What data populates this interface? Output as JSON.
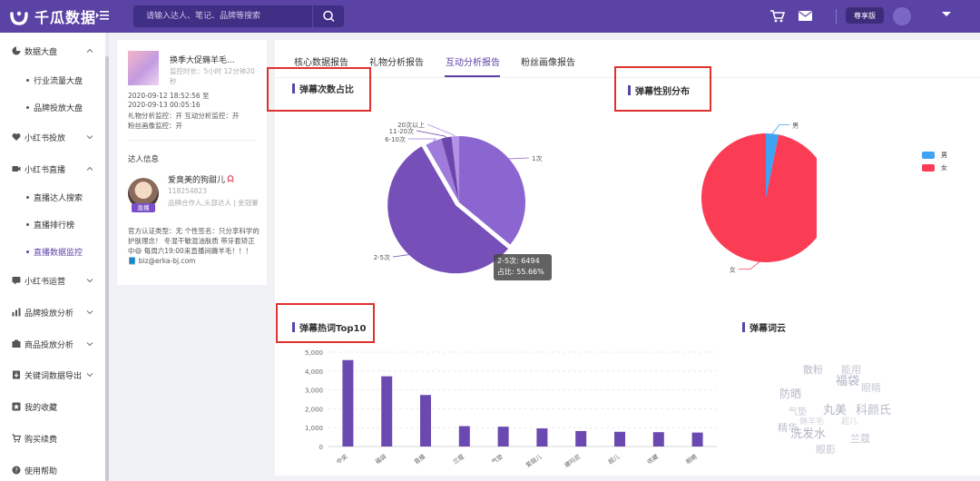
{
  "header": {
    "logo_text": "千瓜数据",
    "search_placeholder": "请输入达人、笔记、品牌等搜索",
    "vip_label": "尊享版"
  },
  "sidebar": {
    "items": [
      {
        "label": "数据大盘",
        "icon": "pie-icon"
      },
      {
        "label": "行业流量大盘",
        "sub": true
      },
      {
        "label": "品牌投放大盘",
        "sub": true
      },
      {
        "label": "小红书投放",
        "icon": "heart-icon"
      },
      {
        "label": "小红书直播",
        "icon": "video-icon"
      },
      {
        "label": "直播达人搜索",
        "sub": true
      },
      {
        "label": "直播排行榜",
        "sub": true
      },
      {
        "label": "直播数据监控",
        "sub": true,
        "active": true
      },
      {
        "label": "小红书运营",
        "icon": "chat-icon"
      },
      {
        "label": "品牌投放分析",
        "icon": "bar-icon"
      },
      {
        "label": "商品投放分析",
        "icon": "goods-icon"
      },
      {
        "label": "关键词数据导出",
        "icon": "export-icon"
      },
      {
        "label": "我的收藏",
        "icon": "star-icon"
      },
      {
        "label": "购买续费",
        "icon": "cart-icon"
      },
      {
        "label": "使用帮助",
        "icon": "help-icon"
      }
    ]
  },
  "live": {
    "title": "换季大促薅羊毛...",
    "duration": "监控时长：5小时 12分钟20秒",
    "lines": [
      "2020-09-12 18:52:56 至",
      "2020-09-13 00:05:16",
      "礼物分析监控：开    互动分析监控：开",
      "粉丝画像监控：开"
    ]
  },
  "kol": {
    "section_title": "达人信息",
    "live_tag": "直播",
    "name": "爱臭美的狗甜儿",
    "id": "118254823",
    "tags": "品牌合作人,头部达人  | 金冠薯",
    "desc": "官方认证类型：无 个性签名：只分享科学的护肤理念！ 冬混干敏混油肤质 带牙套矫正中😄 每周六19:00来直播间薅羊毛！！！ 📘 biz@erka-bj.com"
  },
  "tabs": [
    {
      "label": "核心数据报告"
    },
    {
      "label": "礼物分析报告"
    },
    {
      "label": "互动分析报告",
      "active": true
    },
    {
      "label": "粉丝画像报告"
    }
  ],
  "sections": {
    "danmu_count": "弹幕次数占比",
    "danmu_gender": "弹幕性别分布",
    "danmu_hot": "弹幕热词Top10",
    "danmu_cloud": "弹幕词云"
  },
  "tooltip": {
    "line1": "2-5次: 6494",
    "line2": "占比:  55.66%"
  },
  "chart_data": [
    {
      "type": "pie",
      "title": "弹幕次数占比",
      "slices": [
        {
          "name": "1次",
          "value": 36.0,
          "color": "#8c66d0"
        },
        {
          "name": "2-5次",
          "value": 55.66,
          "color": "#7650b8"
        },
        {
          "name": "6-10次",
          "value": 4.0,
          "color": "#9f7bdb"
        },
        {
          "name": "11-20次",
          "value": 2.5,
          "color": "#6b46ab"
        },
        {
          "name": "20次以上",
          "value": 1.84,
          "color": "#b391e6"
        }
      ]
    },
    {
      "type": "pie",
      "title": "弹幕性别分布",
      "legend": "right",
      "slices": [
        {
          "name": "男",
          "value": 3.2,
          "color": "#3fa2f2"
        },
        {
          "name": "女",
          "value": 96.8,
          "color": "#fb3c55"
        }
      ]
    },
    {
      "type": "bar",
      "title": "弹幕热词Top10",
      "categories": [
        "中奖",
        "福袋",
        "直播",
        "兰蔻",
        "气垫",
        "爱甜儿",
        "娜玛尼",
        "超儿",
        "收藏",
        "眼睛"
      ],
      "values": [
        4580,
        3720,
        2730,
        1080,
        1050,
        960,
        820,
        780,
        760,
        740
      ],
      "ylim": [
        0,
        5000
      ],
      "yticks": [
        "0",
        "1,000",
        "2,000",
        "3,000",
        "4,000",
        "5,000"
      ],
      "color": "#6a4ab0",
      "grid": true
    }
  ],
  "wordcloud": [
    {
      "text": "散粉",
      "size": 11,
      "color": "#b9bccb"
    },
    {
      "text": "能用",
      "size": 11,
      "color": "#c4c6d3"
    },
    {
      "text": "福袋",
      "size": 13,
      "color": "#aeb1c2"
    },
    {
      "text": "眼睛",
      "size": 11,
      "color": "#c9cbd6"
    },
    {
      "text": "防晒",
      "size": 12,
      "color": "#b5b8c8"
    },
    {
      "text": "丸美",
      "size": 13,
      "color": "#b2b5c5"
    },
    {
      "text": "科颜氏",
      "size": 13,
      "color": "#b8bbca"
    },
    {
      "text": "气垫",
      "size": 10,
      "color": "#c8cad5"
    },
    {
      "text": "精华",
      "size": 11,
      "color": "#bec0ce"
    },
    {
      "text": "洗发水",
      "size": 13,
      "color": "#b0b3c3"
    },
    {
      "text": "兰蔻",
      "size": 11,
      "color": "#c0c2cf"
    },
    {
      "text": "眼影",
      "size": 11,
      "color": "#c3c5d1"
    },
    {
      "text": "薅羊毛",
      "size": 9,
      "color": "#d3d5de"
    },
    {
      "text": "超儿",
      "size": 9,
      "color": "#d3d5de"
    }
  ]
}
